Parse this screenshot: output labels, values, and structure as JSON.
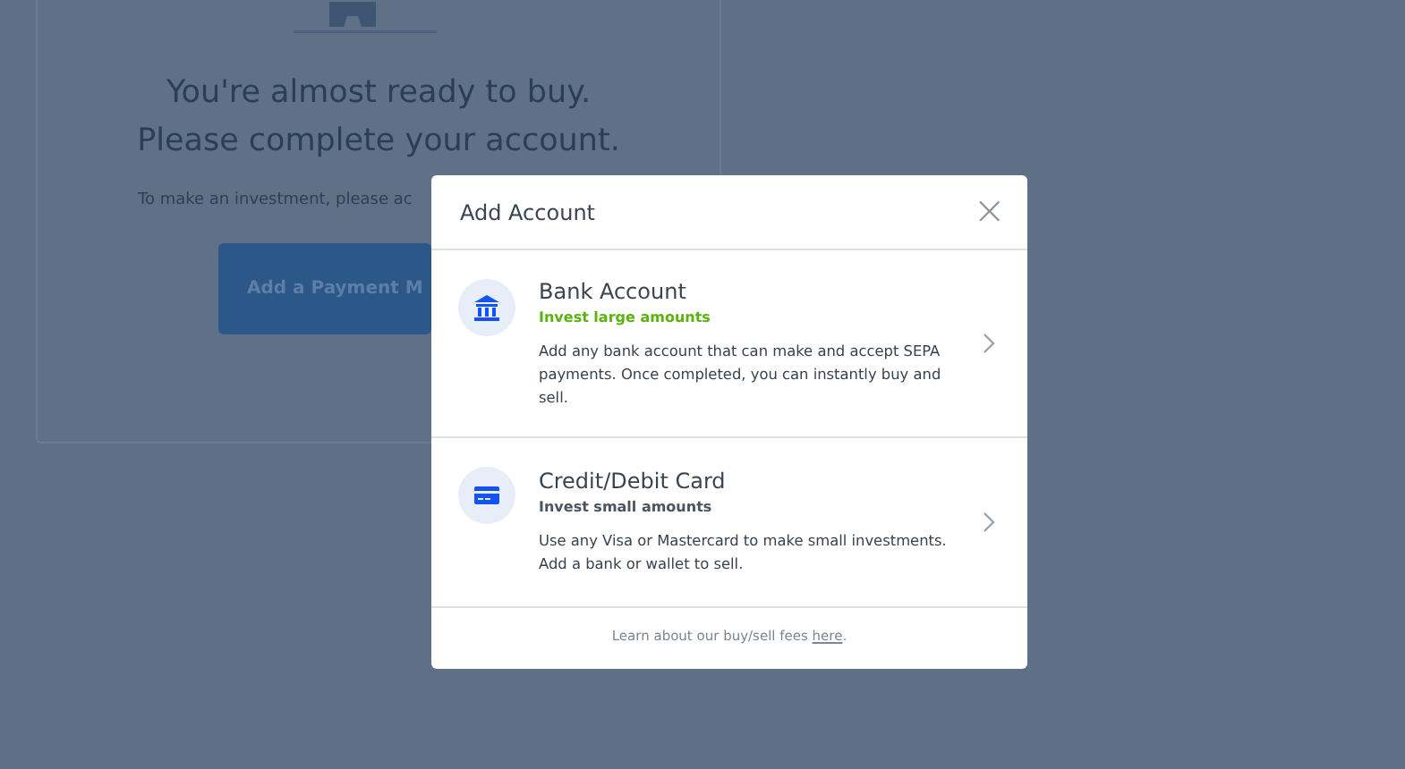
{
  "background": {
    "heading": [
      "You're almost ready to buy.",
      "Please complete your account."
    ],
    "text": "To make an investment, please ac",
    "button": "Add a Payment M"
  },
  "modal": {
    "title": "Add Account",
    "close": "×",
    "options": [
      {
        "kind": "bank",
        "title": "Bank Account",
        "subtitle": "Invest large amounts",
        "highlight": true,
        "description": "Add any bank account that can make and accept SEPA payments. Once completed, you can instantly buy and sell."
      },
      {
        "kind": "card",
        "title": "Credit/Debit Card",
        "subtitle": "Invest small amounts",
        "highlight": false,
        "description": "Use any Visa or Mastercard to make small investments. Add a bank or wallet to sell."
      }
    ],
    "footer": {
      "text": "Learn about our buy/sell fees ",
      "link": "here",
      "end": "."
    }
  }
}
